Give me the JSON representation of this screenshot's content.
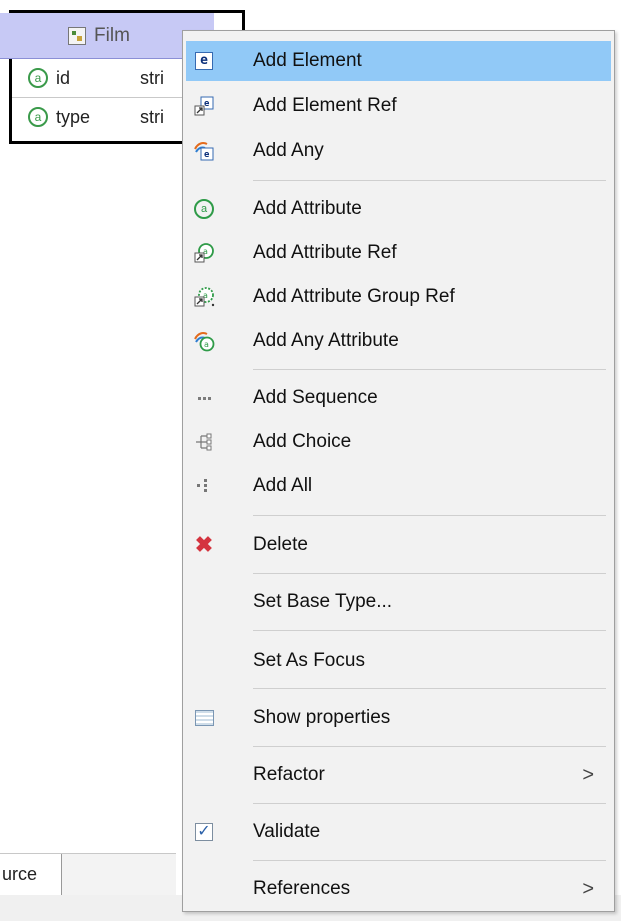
{
  "canvas": {
    "entity": {
      "title": "Film",
      "attributes": [
        {
          "icon": "attribute-icon",
          "name": "id",
          "type": "stri"
        },
        {
          "icon": "attribute-icon",
          "name": "type",
          "type": "stri"
        }
      ]
    },
    "bottom_tab": "urce"
  },
  "context_menu": {
    "items": [
      {
        "label": "Add Element",
        "icon": "element-icon"
      },
      {
        "label": "Add Element Ref",
        "icon": "element-ref-icon"
      },
      {
        "label": "Add Any",
        "icon": "add-any-icon"
      },
      {
        "label": "Add Attribute",
        "icon": "attribute-icon"
      },
      {
        "label": "Add Attribute Ref",
        "icon": "attribute-ref-icon"
      },
      {
        "label": "Add Attribute Group Ref",
        "icon": "attribute-group-ref-icon"
      },
      {
        "label": "Add Any Attribute",
        "icon": "any-attribute-icon"
      },
      {
        "label": "Add Sequence",
        "icon": "sequence-icon"
      },
      {
        "label": "Add Choice",
        "icon": "choice-icon"
      },
      {
        "label": "Add All",
        "icon": "all-icon"
      },
      {
        "label": "Delete",
        "icon": "delete-icon"
      },
      {
        "label": "Set Base Type...",
        "icon": ""
      },
      {
        "label": "Set As Focus",
        "icon": ""
      },
      {
        "label": "Show properties",
        "icon": "properties-icon"
      },
      {
        "label": "Refactor",
        "icon": "",
        "submenu_arrow": ">"
      },
      {
        "label": "Validate",
        "icon": "validate-icon"
      },
      {
        "label": "References",
        "icon": "",
        "submenu_arrow": ">"
      }
    ],
    "highlighted_item": "Add Element"
  },
  "colors": {
    "highlight": "#91c9f7",
    "header": "#c7c9f5",
    "attribute_green": "#2f9b48",
    "delete_red": "#d4343f"
  }
}
